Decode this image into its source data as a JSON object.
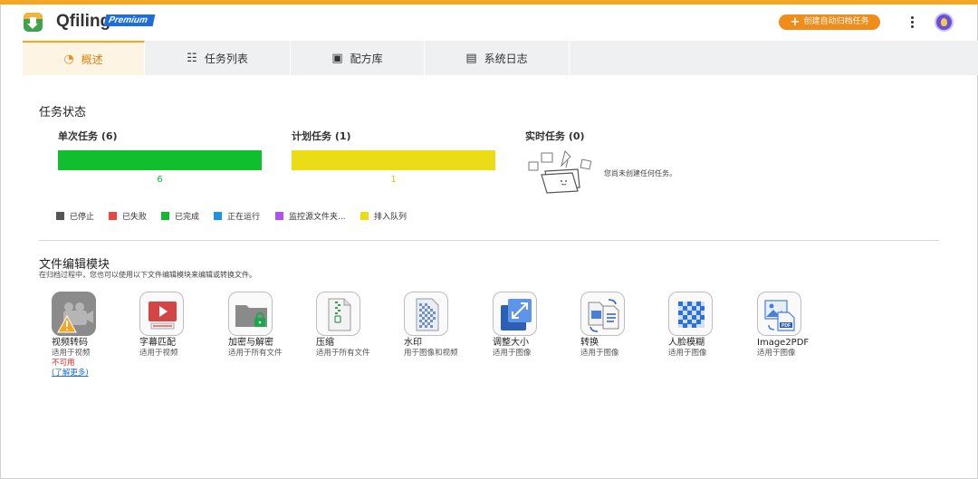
{
  "app": {
    "name": "Qfiling",
    "badge": "Premium"
  },
  "header": {
    "create_button": "创建自动归档任务",
    "more_icon": "more-vertical-icon",
    "avatar_icon": "user-avatar-icon"
  },
  "tabs": [
    {
      "label": "概述",
      "icon": "dashboard-icon",
      "active": true
    },
    {
      "label": "任务列表",
      "icon": "task-list-icon",
      "active": false
    },
    {
      "label": "配方库",
      "icon": "recipe-icon",
      "active": false
    },
    {
      "label": "系统日志",
      "icon": "log-icon",
      "active": false
    }
  ],
  "task_status": {
    "title": "任务状态",
    "groups": [
      {
        "label": "单次任务 (6)",
        "count": "6",
        "color": "#0fbf2d",
        "count_color": "#12b82d"
      },
      {
        "label": "计划任务 (1)",
        "count": "1",
        "color": "#ebdd15",
        "count_color": "#d9c20e"
      },
      {
        "label": "实时任务 (0)",
        "empty_text": "您尚未创建任何任务。"
      }
    ],
    "legend": [
      {
        "label": "已停止",
        "color": "#555555"
      },
      {
        "label": "已失败",
        "color": "#e84545"
      },
      {
        "label": "已完成",
        "color": "#12b82d"
      },
      {
        "label": "正在运行",
        "color": "#1e90e8"
      },
      {
        "label": "监控源文件夹...",
        "color": "#b14ff0"
      },
      {
        "label": "排入队列",
        "color": "#ebdd15"
      }
    ]
  },
  "modules": {
    "title": "文件编辑模块",
    "description": "在归档过程中，您也可以使用以下文件编辑模块来编辑或转换文件。",
    "items": [
      {
        "name": "视频转码",
        "scope": "适用于视频",
        "status": "不可用",
        "link": "(了解更多)",
        "icon": "video-transcode-icon",
        "disabled": true
      },
      {
        "name": "字幕匹配",
        "scope": "适用于视频",
        "icon": "subtitle-icon"
      },
      {
        "name": "加密与解密",
        "scope": "适用于所有文件",
        "icon": "lock-folder-icon"
      },
      {
        "name": "压缩",
        "scope": "适用于所有文件",
        "icon": "zip-icon"
      },
      {
        "name": "水印",
        "scope": "用于图像和视频",
        "icon": "watermark-icon"
      },
      {
        "name": "调整大小",
        "scope": "适用于图像",
        "icon": "resize-icon"
      },
      {
        "name": "转换",
        "scope": "适用于图像",
        "icon": "convert-icon"
      },
      {
        "name": "人脸模糊",
        "scope": "适用于图像",
        "icon": "face-blur-icon"
      },
      {
        "name": "Image2PDF",
        "scope": "适用于图像",
        "icon": "image-to-pdf-icon"
      }
    ]
  }
}
